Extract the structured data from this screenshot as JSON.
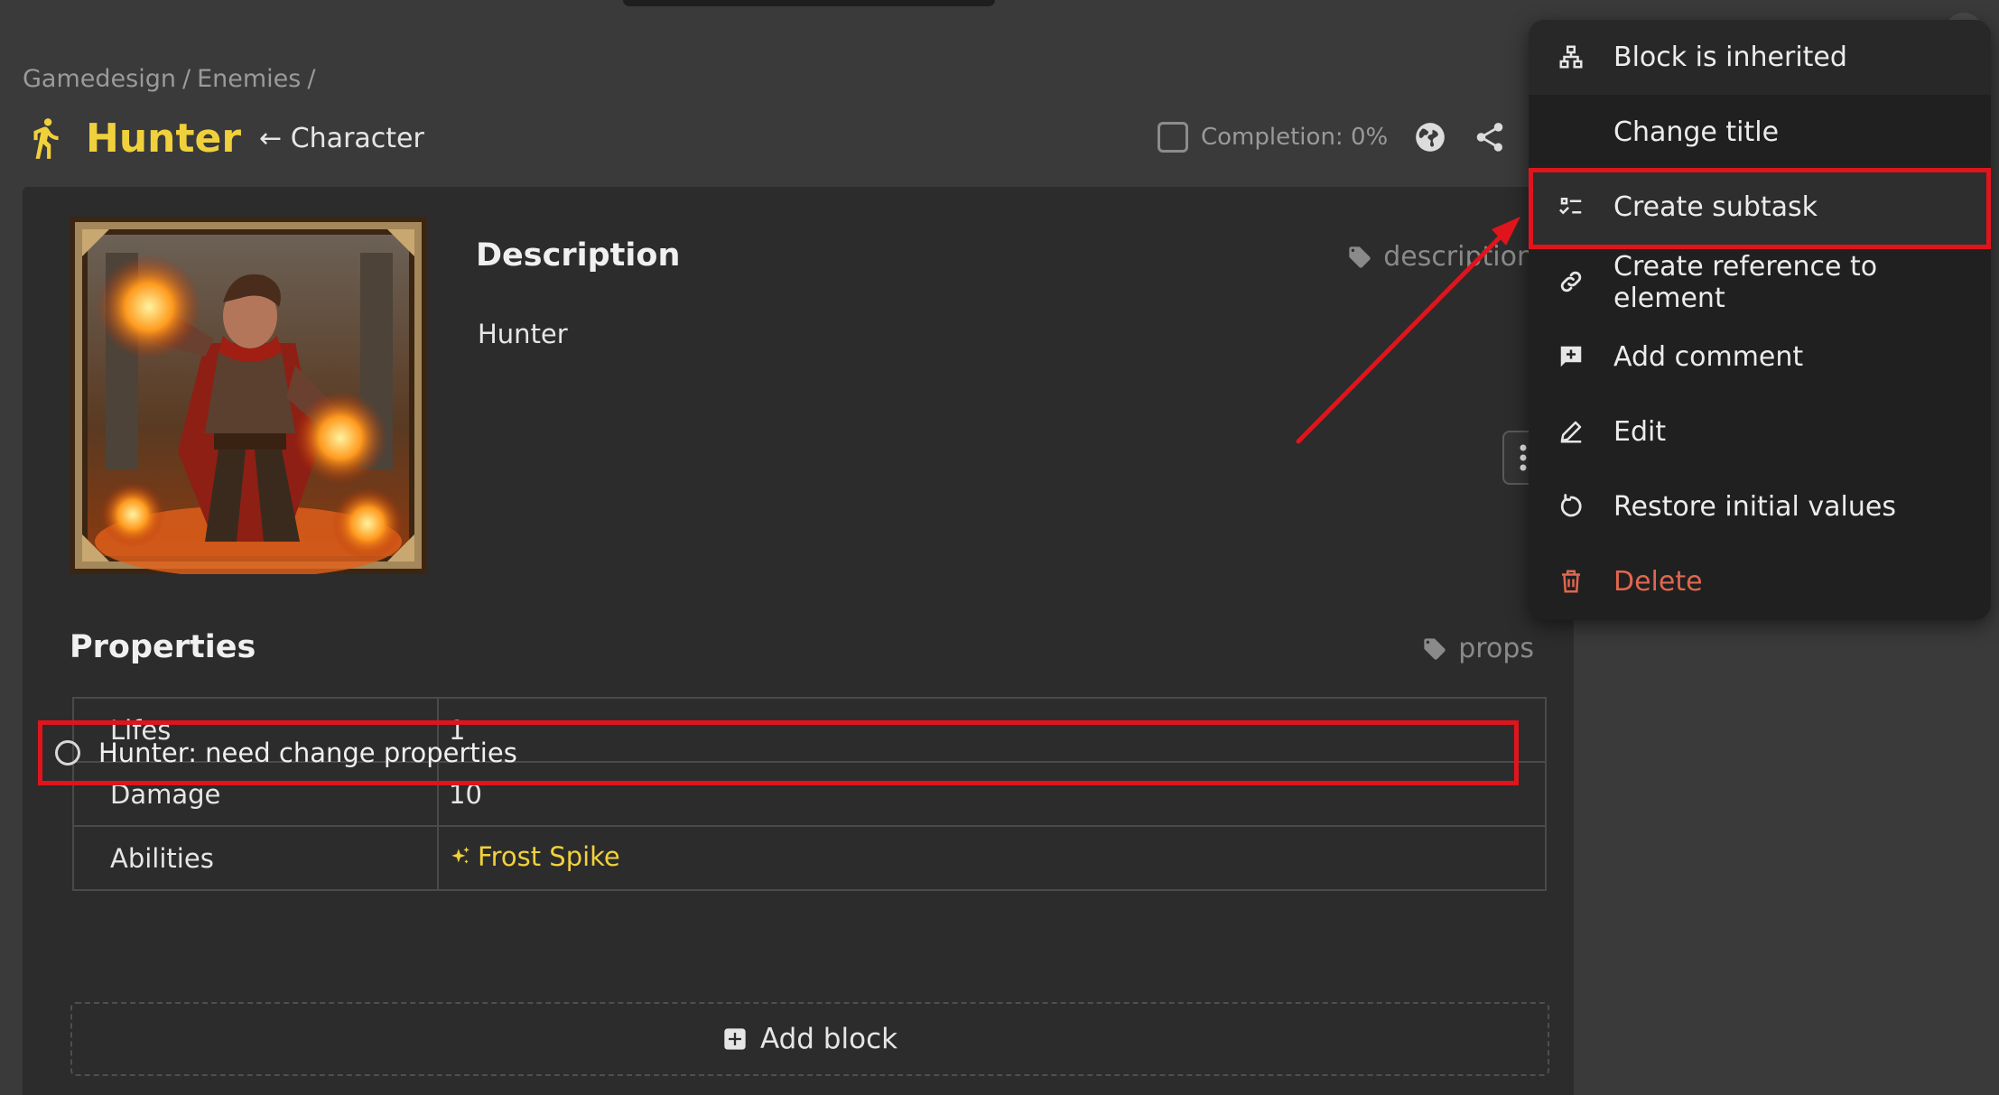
{
  "breadcrumb": {
    "items": [
      "Gamedesign",
      "/",
      "Enemies",
      "/"
    ]
  },
  "header": {
    "title": "Hunter",
    "parent_link": "← Character",
    "completion": "Completion: 0%"
  },
  "description": {
    "heading": "Description",
    "tag": "description",
    "text": "Hunter"
  },
  "properties": {
    "heading": "Properties",
    "tag": "props",
    "rows": [
      {
        "key": "Lifes",
        "value": "1"
      },
      {
        "key": "Damage",
        "value": "10"
      },
      {
        "key": "Abilities",
        "value": "Frost Spike"
      }
    ]
  },
  "subtask": {
    "label": "Hunter: need change properties"
  },
  "add_block": {
    "label": "Add block"
  },
  "menu": {
    "items": [
      {
        "label": "Block is inherited",
        "icon": "hierarchy-icon"
      },
      {
        "label": "Change title",
        "icon": ""
      },
      {
        "label": "Create subtask",
        "icon": "checklist-icon"
      },
      {
        "label": "Create reference to element",
        "icon": "link-icon"
      },
      {
        "label": "Add comment",
        "icon": "comment-add-icon"
      },
      {
        "label": "Edit",
        "icon": "pencil-icon"
      },
      {
        "label": "Restore initial values",
        "icon": "restore-icon"
      },
      {
        "label": "Delete",
        "icon": "trash-icon"
      }
    ]
  },
  "colors": {
    "accent": "#f0d13b",
    "highlight": "#e0141c",
    "danger": "#e0674f",
    "background": "#3a3a3a",
    "panel": "#2c2c2c",
    "menu": "#202020"
  }
}
